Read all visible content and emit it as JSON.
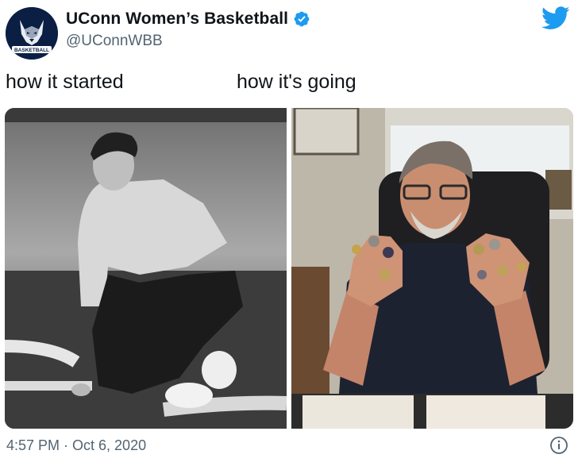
{
  "header": {
    "display_name": "UConn Women’s Basketball",
    "handle": "@UConnWBB",
    "avatar_text": "BASKETBALL"
  },
  "captions": {
    "left": "how it started",
    "right": "how it's going"
  },
  "footer": {
    "timestamp": "4:57 PM · Oct 6, 2020"
  },
  "icons": {
    "verified": "verified-badge-icon",
    "twitter": "twitter-bird-icon",
    "info": "info-icon"
  },
  "colors": {
    "twitter_blue": "#1d9bf0",
    "text_secondary": "#536471",
    "avatar_navy": "#0b1f44"
  }
}
